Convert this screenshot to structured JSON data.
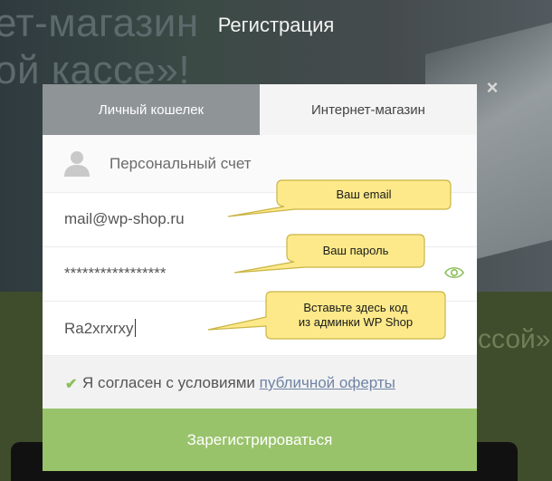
{
  "background": {
    "headline_line1": "ет-магазин",
    "headline_line2": "ой кассе»!",
    "green_text": "ссой»"
  },
  "modal": {
    "title": "Регистрация",
    "close_symbol": "×",
    "tabs": [
      {
        "label": "Личный кошелек",
        "active": false
      },
      {
        "label": "Интернет-магазин",
        "active": true
      }
    ],
    "account_label": "Персональный счет",
    "email_value": "mail@wp-shop.ru",
    "password_value": "*****************",
    "code_value": "Ra2xrxrxy",
    "agree_text": "Я согласен с условиями",
    "agree_link": "публичной оферты",
    "submit_label": "Зарегистрироваться"
  },
  "callouts": {
    "email": "Ваш email",
    "password": "Ваш пароль",
    "code_line1": "Вставьте здесь код",
    "code_line2": "из админки WP Shop"
  },
  "colors": {
    "accent_green": "#99c36b",
    "check_green": "#8bbf5a",
    "tab_inactive": "#8f9497",
    "callout_fill": "#fde98a",
    "link": "#6f83a5"
  }
}
